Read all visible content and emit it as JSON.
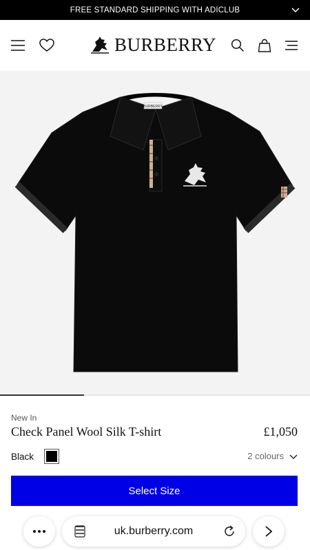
{
  "banner": {
    "text": "FREE STANDARD SHIPPING WITH ADICLUB"
  },
  "header": {
    "brand": "BURBERRY"
  },
  "gallery": {
    "label_tag": "BURBERRY",
    "progress": 0.27
  },
  "product": {
    "badge": "New In",
    "name": "Check Panel Wool Silk T-shirt",
    "price": "£1,050",
    "color_name": "Black",
    "swatch_color": "#000000",
    "colours_label": "2 colours",
    "select_size_label": "Select Size"
  },
  "browser": {
    "url": "uk.burberry.com"
  },
  "colors": {
    "accent": "#0000E6",
    "banner_bg": "#000000",
    "hero_bg": "#F3F3F3"
  }
}
